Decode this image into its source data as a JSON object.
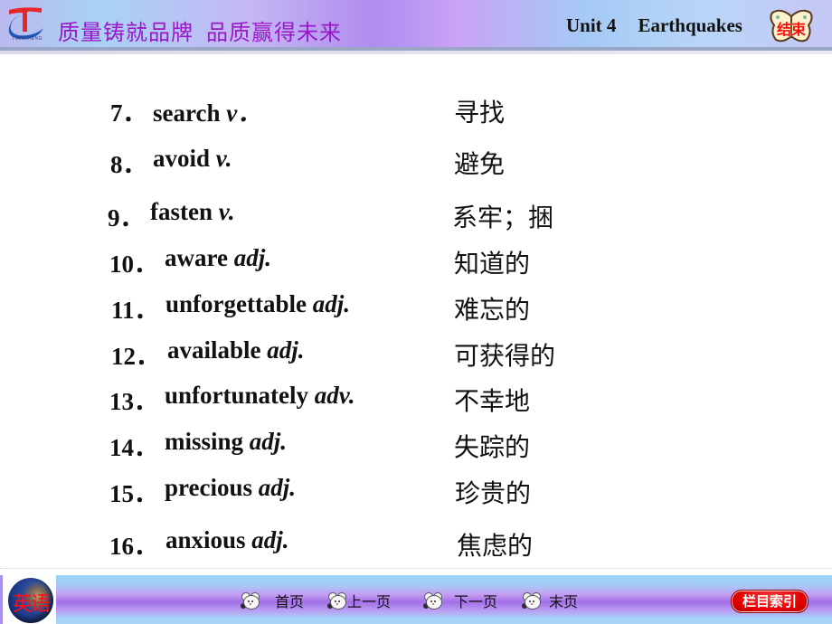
{
  "header": {
    "logo_text": "TIANCHENG",
    "slogan_part1": "质量铸就品牌",
    "slogan_part2": "品质赢得未来",
    "unit_label": "Unit 4",
    "unit_topic": "Earthquakes",
    "end_button_label": "结束"
  },
  "vocab": [
    {
      "num": "7．",
      "word": "search",
      "pos": "v．",
      "meaning": "寻找"
    },
    {
      "num": "8．",
      "word": "avoid",
      "pos": "v.",
      "meaning": "避免"
    },
    {
      "num": "9．",
      "word": "fasten",
      "pos": "v.",
      "meaning": "系牢；捆"
    },
    {
      "num": "10．",
      "word": "aware",
      "pos": "adj.",
      "meaning": "知道的"
    },
    {
      "num": "11．",
      "word": "unforgettable",
      "pos": "adj.",
      "meaning": "难忘的"
    },
    {
      "num": "12．",
      "word": "available",
      "pos": "adj.",
      "meaning": "可获得的"
    },
    {
      "num": "13．",
      "word": "unfortunately",
      "pos": "adv.",
      "meaning": "不幸地"
    },
    {
      "num": "14．",
      "word": "missing",
      "pos": "adj.",
      "meaning": "失踪的"
    },
    {
      "num": "15．",
      "word": "precious",
      "pos": "adj.",
      "meaning": "珍贵的"
    },
    {
      "num": "16．",
      "word": "anxious",
      "pos": "adj.",
      "meaning": "焦虑的"
    }
  ],
  "footer": {
    "subject_label": "英语",
    "nav": {
      "first": "首页",
      "prev": "上一页",
      "next": "下一页",
      "last": "末页"
    },
    "index_button": "栏目索引"
  },
  "colors": {
    "slogan": "#9a18c8",
    "end_label": "#ff0a0a",
    "index_button_bg": "#e60000",
    "subject_label": "#ff1010"
  }
}
